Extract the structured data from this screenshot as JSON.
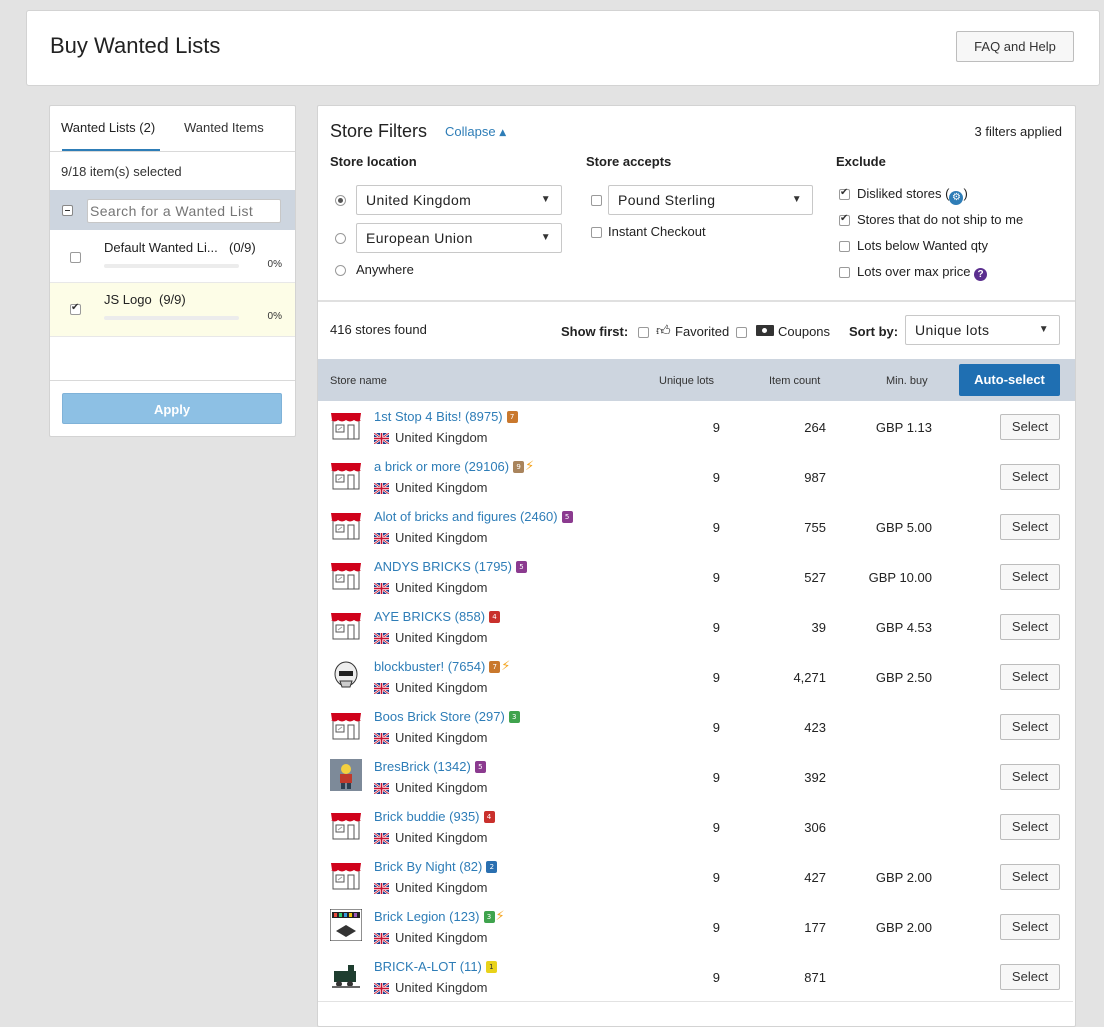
{
  "header": {
    "title": "Buy Wanted Lists",
    "help_label": "FAQ and Help"
  },
  "left": {
    "tab_lists": "Wanted Lists (2)",
    "tab_items": "Wanted Items",
    "selected_summary": "9/18 item(s) selected",
    "search_placeholder": "Search for a Wanted List",
    "lists": [
      {
        "name": "Default Wanted Li...",
        "count": "(0/9)",
        "progress": "0%",
        "checked": false
      },
      {
        "name": "JS Logo",
        "count": "(9/9)",
        "progress": "0%",
        "checked": true
      }
    ],
    "apply_label": "Apply"
  },
  "filters": {
    "title": "Store Filters",
    "collapse_label": "Collapse",
    "applied": "3 filters applied",
    "location_label": "Store location",
    "location_options": [
      "United Kingdom",
      "European Union",
      "Anywhere"
    ],
    "accepts_label": "Store accepts",
    "currency": "Pound Sterling",
    "instant_checkout": "Instant Checkout",
    "exclude_label": "Exclude",
    "exclude_items": [
      "Disliked stores (",
      ")",
      "Stores that do not ship to me",
      "Lots below Wanted qty",
      "Lots over max price"
    ]
  },
  "results": {
    "found": "416 stores found",
    "show_first": "Show first:",
    "favorited": "Favorited",
    "coupons": "Coupons",
    "sort_by": "Sort by:",
    "sort_value": "Unique lots"
  },
  "table": {
    "col_store": "Store name",
    "col_lots": "Unique lots",
    "col_count": "Item count",
    "col_min": "Min. buy",
    "autoselect": "Auto-select",
    "select_label": "Select",
    "rows": [
      {
        "name": "1st Stop 4 Bits! (8975)",
        "country": "United Kingdom",
        "lots": "9",
        "count": "264",
        "min": "GBP 1.13",
        "badge": "7",
        "badge_color": "#c9782d",
        "bolt": false,
        "logo": "storefront"
      },
      {
        "name": "a brick or more (29106)",
        "country": "United Kingdom",
        "lots": "9",
        "count": "987",
        "min": "",
        "badge": "9",
        "badge_color": "#a9845c",
        "bolt": true,
        "logo": "storefront"
      },
      {
        "name": "Alot of bricks and figures (2460)",
        "country": "United Kingdom",
        "lots": "9",
        "count": "755",
        "min": "GBP 5.00",
        "badge": "5",
        "badge_color": "#8b3a8f",
        "bolt": false,
        "logo": "storefront"
      },
      {
        "name": "ANDYS BRICKS (1795)",
        "country": "United Kingdom",
        "lots": "9",
        "count": "527",
        "min": "GBP 10.00",
        "badge": "5",
        "badge_color": "#8b3a8f",
        "bolt": false,
        "logo": "storefront"
      },
      {
        "name": "AYE BRICKS (858)",
        "country": "United Kingdom",
        "lots": "9",
        "count": "39",
        "min": "GBP 4.53",
        "badge": "4",
        "badge_color": "#c9302c",
        "bolt": false,
        "logo": "storefront"
      },
      {
        "name": "blockbuster! (7654)",
        "country": "United Kingdom",
        "lots": "9",
        "count": "4,271",
        "min": "GBP 2.50",
        "badge": "7",
        "badge_color": "#c9782d",
        "bolt": true,
        "logo": "trooper"
      },
      {
        "name": "Boos Brick Store (297)",
        "country": "United Kingdom",
        "lots": "9",
        "count": "423",
        "min": "",
        "badge": "3",
        "badge_color": "#3fa34d",
        "bolt": false,
        "logo": "storefront"
      },
      {
        "name": "BresBrick (1342)",
        "country": "United Kingdom",
        "lots": "9",
        "count": "392",
        "min": "",
        "badge": "5",
        "badge_color": "#8b3a8f",
        "bolt": false,
        "logo": "minifig"
      },
      {
        "name": "Brick buddie (935)",
        "country": "United Kingdom",
        "lots": "9",
        "count": "306",
        "min": "",
        "badge": "4",
        "badge_color": "#c9302c",
        "bolt": false,
        "logo": "storefront"
      },
      {
        "name": "Brick By Night (82)",
        "country": "United Kingdom",
        "lots": "9",
        "count": "427",
        "min": "GBP 2.00",
        "badge": "2",
        "badge_color": "#2a6fb0",
        "bolt": false,
        "logo": "storefront"
      },
      {
        "name": "Brick Legion (123)",
        "country": "United Kingdom",
        "lots": "9",
        "count": "177",
        "min": "GBP 2.00",
        "badge": "3",
        "badge_color": "#3fa34d",
        "bolt": true,
        "logo": "legion"
      },
      {
        "name": "BRICK-A-LOT (11)",
        "country": "United Kingdom",
        "lots": "9",
        "count": "871",
        "min": "",
        "badge": "1",
        "badge_color": "#e8d21a",
        "bolt": false,
        "logo": "train"
      }
    ]
  },
  "colors": {
    "accent": "#2e7db7",
    "autoselect_bg": "#1f6fb2",
    "apply_bg": "#8dc0e4",
    "table_header_bg": "#cdd5df"
  }
}
